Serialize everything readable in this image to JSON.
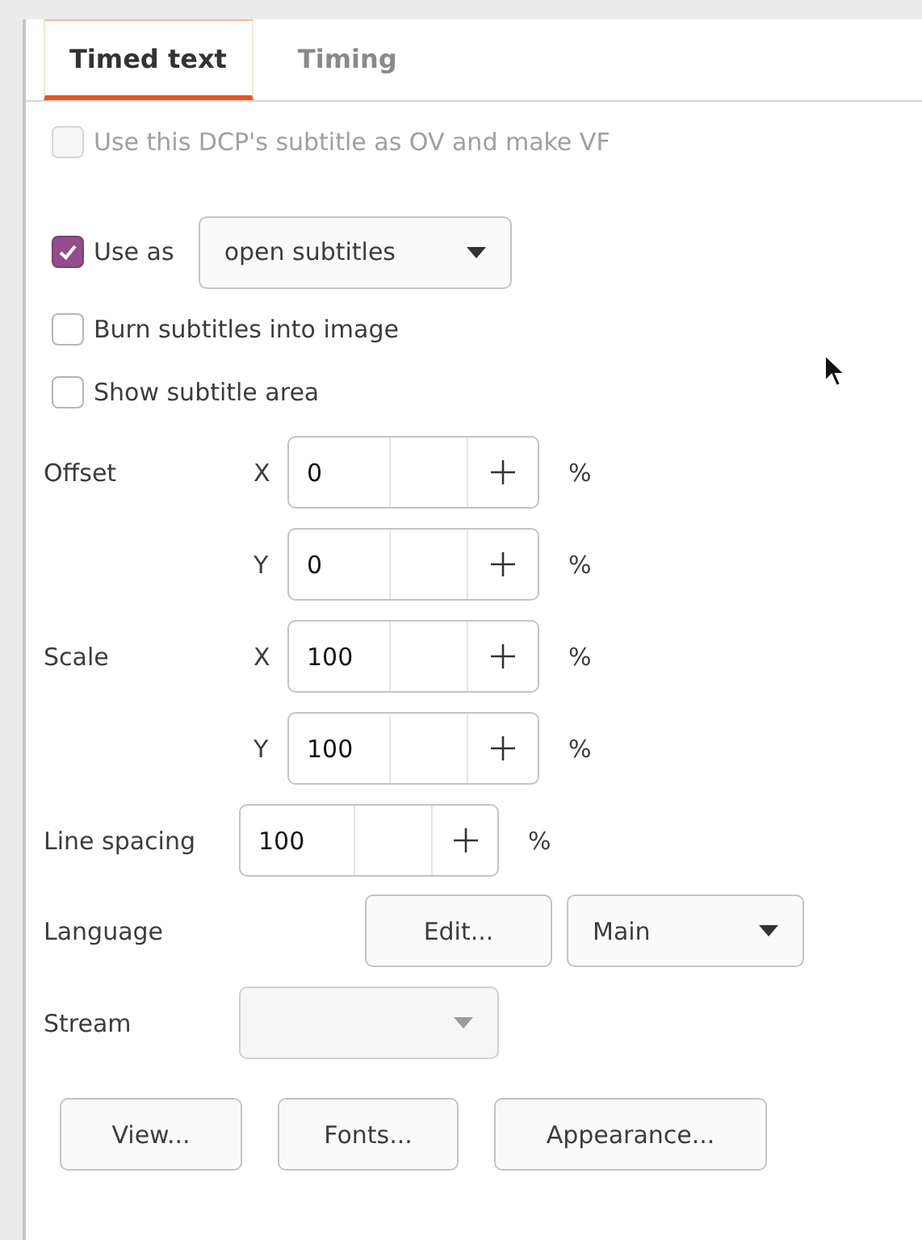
{
  "tabs": [
    {
      "label": "Timed text",
      "selected": true
    },
    {
      "label": "Timing",
      "selected": false
    }
  ],
  "ov_checkbox": {
    "label": "Use this DCP's subtitle as OV and make VF",
    "checked": false,
    "disabled": true
  },
  "use_as": {
    "label": "Use as",
    "checked": true,
    "value": "open subtitles"
  },
  "options": [
    {
      "label": "Burn subtitles into image",
      "checked": false
    },
    {
      "label": "Show subtitle area",
      "checked": false
    }
  ],
  "spin_rows": [
    {
      "label": "Offset",
      "axis": "X",
      "value": "0",
      "unit": "%"
    },
    {
      "axis": "Y",
      "value": "0",
      "unit": "%"
    },
    {
      "label": "Scale",
      "axis": "X",
      "value": "100",
      "unit": "%"
    },
    {
      "axis": "Y",
      "value": "100",
      "unit": "%"
    }
  ],
  "line_spacing": {
    "label": "Line spacing",
    "value": "100",
    "unit": "%"
  },
  "language": {
    "label": "Language",
    "button": "Edit...",
    "value": "Main"
  },
  "stream": {
    "label": "Stream",
    "disabled": true
  },
  "buttons": [
    "View...",
    "Fonts...",
    "Appearance..."
  ]
}
